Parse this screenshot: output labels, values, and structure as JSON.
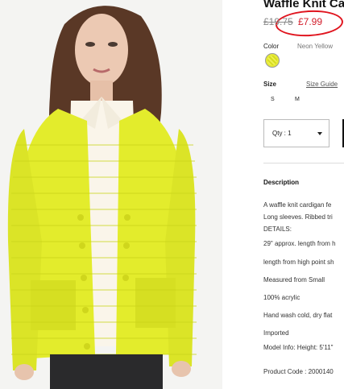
{
  "product": {
    "title": "Waffle Knit Ca",
    "old_price": "£19.75",
    "new_price": "£7.99",
    "color_label": "Color",
    "color_name": "Neon Yellow",
    "swatch_color": "#e6ea35",
    "size_label": "Size",
    "size_guide": "Size Guide",
    "sizes": [
      "S",
      "M"
    ],
    "qty_label": "Qty : 1",
    "description_heading": "Description",
    "description_lines": [
      "A waffle knit cardigan fe",
      "Long sleeves. Ribbed tri",
      "DETAILS:",
      "29\" approx. length from h",
      "length from high point sh",
      "Measured from Small",
      "100% acrylic",
      "Hand wash cold, dry flat",
      "Imported",
      "Model Info: Height: 5'11\"",
      "Product Code : 2000140"
    ]
  },
  "annotation": {
    "circle_color": "#e0141e"
  },
  "colors": {
    "sale_red": "#d21c2a",
    "cardigan": "#e3ec2c"
  }
}
